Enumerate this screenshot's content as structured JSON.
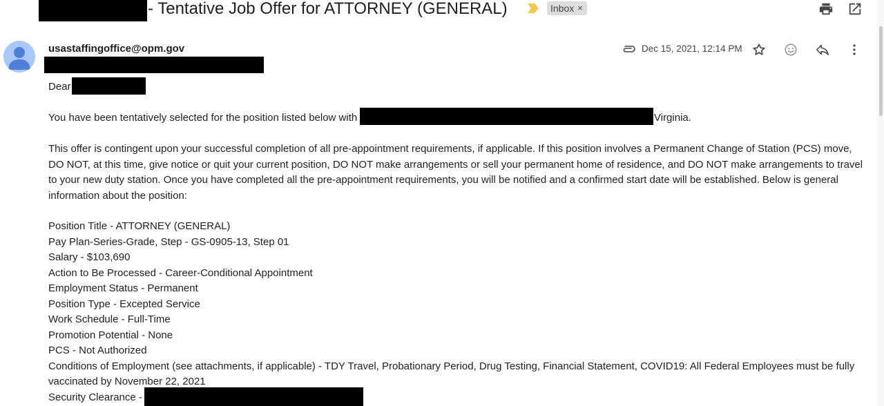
{
  "email": {
    "subject": "- Tentative Job Offer for ATTORNEY (GENERAL)",
    "label": "Inbox",
    "label_remove": "×",
    "sender": "usastaffingoffice@opm.gov",
    "date": "Dec 15, 2021, 12:14 PM",
    "icons": {
      "importance": "importance-marker-icon",
      "print": "print-icon",
      "new_window": "open-in-new-window-icon",
      "avatar": "person-avatar-icon",
      "attachment": "paperclip-icon",
      "star": "star-icon",
      "emoji": "emoji-reaction-icon",
      "reply": "reply-icon",
      "more": "more-vertical-icon"
    },
    "colors": {
      "importance": "#f2c94c",
      "label_bg": "#dddddd",
      "avatar_bg": "#a8c7fa",
      "avatar_fg": "#4f7fd6",
      "redaction": "#000000"
    }
  },
  "body": {
    "greeting": "Dear",
    "selected_text": "You have been tentatively selected for the position listed below with",
    "selected_location": "Virginia.",
    "contingency": "This offer is contingent upon your successful completion of all pre-appointment requirements, if applicable. If this position involves a Permanent Change of Station (PCS) move, DO NOT, at this time, give notice or quit your current position, DO NOT make arrangements or sell your permanent home of residence, and DO NOT make arrangements to travel to your new duty station. Once you have completed all the pre-appointment requirements, you will be notified and a confirmed start date will be established. Below is general information about the position:",
    "details": [
      "Position Title - ATTORNEY (GENERAL)",
      "Pay Plan-Series-Grade, Step - GS-0905-13, Step 01",
      "Salary - $103,690",
      "Action to Be Processed - Career-Conditional Appointment",
      "Employment Status - Permanent",
      "Position Type - Excepted Service",
      "Work Schedule - Full-Time",
      "Promotion Potential - None",
      "PCS - Not Authorized"
    ],
    "conditions": "Conditions of Employment (see attachments, if applicable) - TDY Travel, Probationary Period, Drug Testing, Financial Statement, COVID19: All Federal Employees must be fully vaccinated by November 22, 2021",
    "security_clearance": "Security Clearance -"
  }
}
